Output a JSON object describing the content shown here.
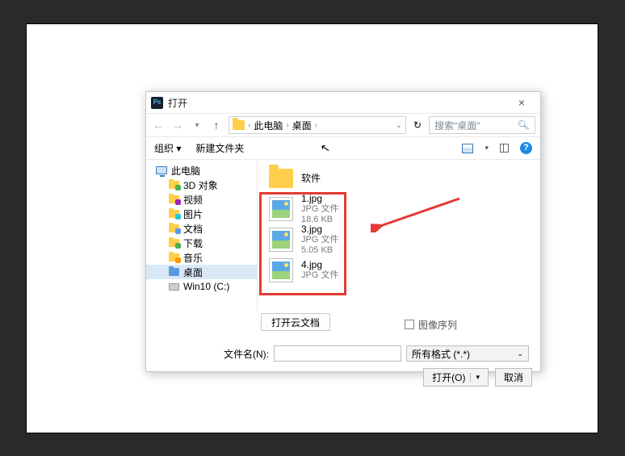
{
  "title": "打开",
  "nav": {
    "back": "←",
    "fwd": "→",
    "up": "↑",
    "crumb1": "此电脑",
    "crumb2": "桌面",
    "search_placeholder": "搜索\"桌面\"",
    "refresh": "↻"
  },
  "toolbar": {
    "organize": "组织 ▾",
    "newfolder": "新建文件夹"
  },
  "sidebar": [
    {
      "label": "此电脑",
      "icon": "monitor"
    },
    {
      "label": "3D 对象",
      "icon": "green",
      "child": true
    },
    {
      "label": "视频",
      "icon": "vid",
      "child": true
    },
    {
      "label": "图片",
      "icon": "cyan",
      "child": true
    },
    {
      "label": "文档",
      "icon": "doc",
      "child": true
    },
    {
      "label": "下载",
      "icon": "down",
      "child": true
    },
    {
      "label": "音乐",
      "icon": "music",
      "child": true
    },
    {
      "label": "桌面",
      "icon": "blue",
      "child": true,
      "selected": true
    },
    {
      "label": "Win10 (C:)",
      "icon": "disk",
      "child": true
    }
  ],
  "files": [
    {
      "name": "软件",
      "type": "folder"
    },
    {
      "name": "1.jpg",
      "line2": "JPG 文件",
      "line3": "18.6 KB",
      "type": "jpg"
    },
    {
      "name": "3.jpg",
      "line2": "JPG 文件",
      "line3": "5.05 KB",
      "type": "jpg"
    },
    {
      "name": "4.jpg",
      "line2": "JPG 文件",
      "line3": "",
      "type": "jpg"
    }
  ],
  "cloudbtn": "打开云文档",
  "checkbox_label": "图像序列",
  "filename_label": "文件名(N):",
  "filetype": "所有格式 (*.*)",
  "open_btn": "打开(O)",
  "cancel_btn": "取消",
  "close_x": "×",
  "help": "?"
}
